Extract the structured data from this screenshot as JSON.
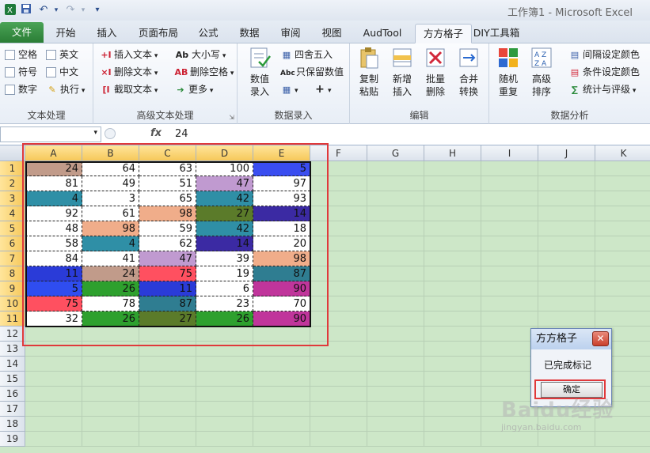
{
  "window": {
    "title": "工作簿1 - Microsoft Excel"
  },
  "tabs": [
    "文件",
    "开始",
    "插入",
    "页面布局",
    "公式",
    "数据",
    "审阅",
    "视图",
    "AudTool",
    "方方格子",
    "DIY工具箱"
  ],
  "ribbon": {
    "text_group": {
      "label": "文本处理",
      "options": [
        "空格",
        "英文",
        "符号",
        "中文",
        "数字"
      ],
      "exec": "执行"
    },
    "adv_text_group": {
      "label": "高级文本处理",
      "insert": "插入文本",
      "delete": "删除文本",
      "extract": "截取文本",
      "case": "大小写",
      "del_space": "删除空格",
      "more": "更多"
    },
    "input_group": {
      "label": "数据录入",
      "input": "数值\n录入",
      "round": "四舍五入",
      "keep": "只保留数值"
    },
    "edit_group": {
      "label": "编辑",
      "copy_paste": "复制\n粘贴",
      "new_insert": "新增\n插入",
      "batch_delete": "批量\n删除",
      "merge_convert": "合并\n转换"
    },
    "analysis_group": {
      "label": "数据分析",
      "random": "随机\n重复",
      "adv_sort": "高级\n排序",
      "interval_color": "间隔设定颜色",
      "cond_color": "条件设定颜色",
      "stats": "统计与评级"
    }
  },
  "formula_bar": {
    "fx": "fx",
    "value": "24"
  },
  "columns": [
    "A",
    "B",
    "C",
    "D",
    "E",
    "F",
    "G",
    "H",
    "I",
    "J",
    "K"
  ],
  "rows": [
    "1",
    "2",
    "3",
    "4",
    "5",
    "6",
    "7",
    "8",
    "9",
    "10",
    "11",
    "12",
    "13",
    "14",
    "15",
    "16",
    "17",
    "18",
    "19"
  ],
  "table": [
    [
      24,
      64,
      63,
      100,
      5
    ],
    [
      81,
      49,
      51,
      47,
      97
    ],
    [
      4,
      3,
      65,
      42,
      93
    ],
    [
      92,
      61,
      98,
      27,
      14
    ],
    [
      48,
      98,
      59,
      42,
      18
    ],
    [
      58,
      4,
      62,
      14,
      20
    ],
    [
      84,
      41,
      47,
      39,
      98
    ],
    [
      11,
      24,
      75,
      19,
      87
    ],
    [
      5,
      26,
      11,
      6,
      90
    ],
    [
      75,
      78,
      87,
      23,
      70
    ],
    [
      32,
      26,
      27,
      26,
      90
    ]
  ],
  "cell_colors": [
    [
      "#c19b8a",
      "#ffffff",
      "#ffffff",
      "#ffffff",
      "#3a4df0"
    ],
    [
      "#ffffff",
      "#ffffff",
      "#ffffff",
      "#c09ad0",
      "#ffffff"
    ],
    [
      "#2f8fa6",
      "#ffffff",
      "#ffffff",
      "#2f8fa6",
      "#ffffff"
    ],
    [
      "#ffffff",
      "#ffffff",
      "#f0ad8a",
      "#5b7b2a",
      "#3b2aa3"
    ],
    [
      "#ffffff",
      "#f0ad8a",
      "#ffffff",
      "#2f8fa6",
      "#ffffff"
    ],
    [
      "#ffffff",
      "#2f8fa6",
      "#ffffff",
      "#3b2aa3",
      "#ffffff"
    ],
    [
      "#ffffff",
      "#ffffff",
      "#c09ad0",
      "#ffffff",
      "#f0ad8a"
    ],
    [
      "#2a3bd8",
      "#c19b8a",
      "#ff5060",
      "#ffffff",
      "#2f7d91"
    ],
    [
      "#2f4df0",
      "#2ea02e",
      "#2a3bd8",
      "#ffffff",
      "#c0359b"
    ],
    [
      "#ff5060",
      "#ffffff",
      "#2f7d91",
      "#ffffff",
      "#ffffff"
    ],
    [
      "#ffffff",
      "#2ea02e",
      "#5b7b2a",
      "#2ea02e",
      "#c0359b"
    ]
  ],
  "dialog": {
    "title": "方方格子",
    "message": "已完成标记",
    "ok": "确定"
  },
  "watermark": {
    "brand": "Baidu经验",
    "url": "jingyan.baidu.com"
  }
}
